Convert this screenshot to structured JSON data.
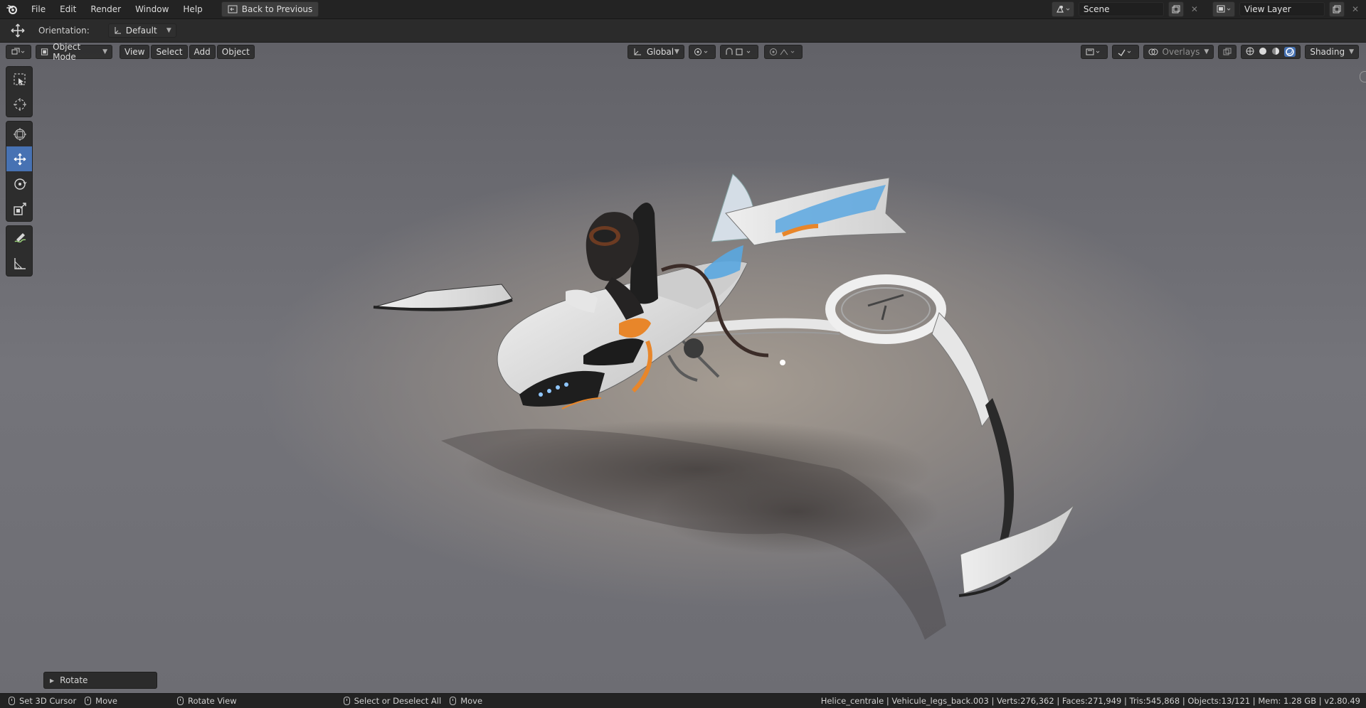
{
  "menu": {
    "items": [
      "File",
      "Edit",
      "Render",
      "Window",
      "Help"
    ],
    "back_label": "Back to Previous"
  },
  "top_right": {
    "scene_name": "Scene",
    "view_layer_name": "View Layer"
  },
  "tool_settings": {
    "orientation_label": "Orientation:",
    "orientation_value": "Default"
  },
  "viewport_header": {
    "mode": "Object Mode",
    "menus": [
      "View",
      "Select",
      "Add",
      "Object"
    ],
    "transform_orientation": "Global",
    "overlays_label": "Overlays",
    "shading_label": "Shading"
  },
  "toolbar": {
    "tools": [
      "select-box-icon",
      "cursor-icon",
      "move-transform-icon",
      "move-icon",
      "rotate-icon",
      "scale-icon",
      "annotate-icon",
      "measure-icon"
    ],
    "active_tool": "move-icon"
  },
  "operator_panel": {
    "label": "Rotate"
  },
  "statusbar": {
    "hints": [
      "Set 3D Cursor",
      "Move",
      "Rotate View",
      "Select or Deselect All",
      "Move"
    ],
    "stats": "Helice_centrale | Vehicule_legs_back.003 | Verts:276,362 | Faces:271,949 | Tris:545,868 | Objects:13/121 | Mem: 1.28 GB | v2.80.49"
  },
  "colors": {
    "accent": "#4772b3",
    "vehicle_orange": "#e8862a",
    "vehicle_blue": "#5aa7e0"
  }
}
